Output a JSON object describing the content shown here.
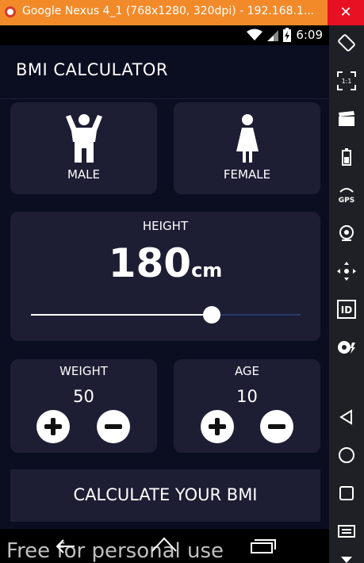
{
  "window": {
    "title": "Google Nexus 4_1 (768x1280, 320dpi) - 192.168.1...",
    "close_label": "✕"
  },
  "statusbar": {
    "time": "6:09",
    "icons": [
      "wifi-icon",
      "signal-icon",
      "battery-icon"
    ]
  },
  "app": {
    "title": "BMI CALCULATOR",
    "gender": {
      "male_label": "MALE",
      "female_label": "FEMALE"
    },
    "height": {
      "label": "HEIGHT",
      "value": "180",
      "unit": "cm",
      "slider_fraction": 0.67
    },
    "weight": {
      "label": "WEIGHT",
      "value": "50"
    },
    "age": {
      "label": "AGE",
      "value": "10"
    },
    "calculate_label": "CALCULATE YOUR BMI"
  },
  "watermark": "Free for personal use",
  "sidepanel": {
    "buttons": [
      "rotate-icon",
      "scale-icon",
      "clapper-icon",
      "battery-icon",
      "gps-icon",
      "camera-icon",
      "dpad-icon",
      "id-icon",
      "media-icon",
      "back-icon",
      "home-icon",
      "recents-icon",
      "menu-icon",
      "volume-down-icon"
    ],
    "gps_text": "GPS",
    "id_text": "ID",
    "scale_text": "1:1"
  },
  "colors": {
    "background": "#0b0e21",
    "card": "#1d1e33",
    "accent": "#ffffff",
    "titlebar": "#f28a2a"
  }
}
